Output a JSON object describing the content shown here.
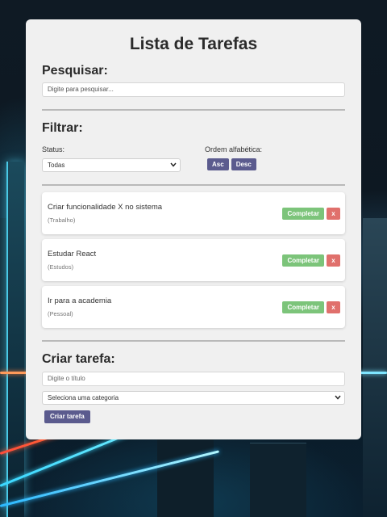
{
  "page": {
    "title": "Lista de Tarefas"
  },
  "search": {
    "heading": "Pesquisar:",
    "placeholder": "Digite para pesquisar..."
  },
  "filter": {
    "heading": "Filtrar:",
    "status_label": "Status:",
    "status_selected": "Todas",
    "sort_label": "Ordem alfabética:",
    "asc_label": "Asc",
    "desc_label": "Desc"
  },
  "tasks": [
    {
      "title": "Criar funcionalidade X no sistema",
      "category": "(Trabalho)",
      "complete_label": "Completar",
      "remove_label": "x"
    },
    {
      "title": "Estudar React",
      "category": "(Estudos)",
      "complete_label": "Completar",
      "remove_label": "x"
    },
    {
      "title": "Ir para a academia",
      "category": "(Pessoal)",
      "complete_label": "Completar",
      "remove_label": "x"
    }
  ],
  "create": {
    "heading": "Criar tarefa:",
    "title_placeholder": "Digite o título",
    "category_selected": "Seleciona uma categoria",
    "submit_label": "Criar tarefa"
  },
  "colors": {
    "primary_button": "#5b5b8e",
    "complete_button": "#7cc47a",
    "remove_button": "#e0706c",
    "card_background": "#f0f0f0"
  }
}
